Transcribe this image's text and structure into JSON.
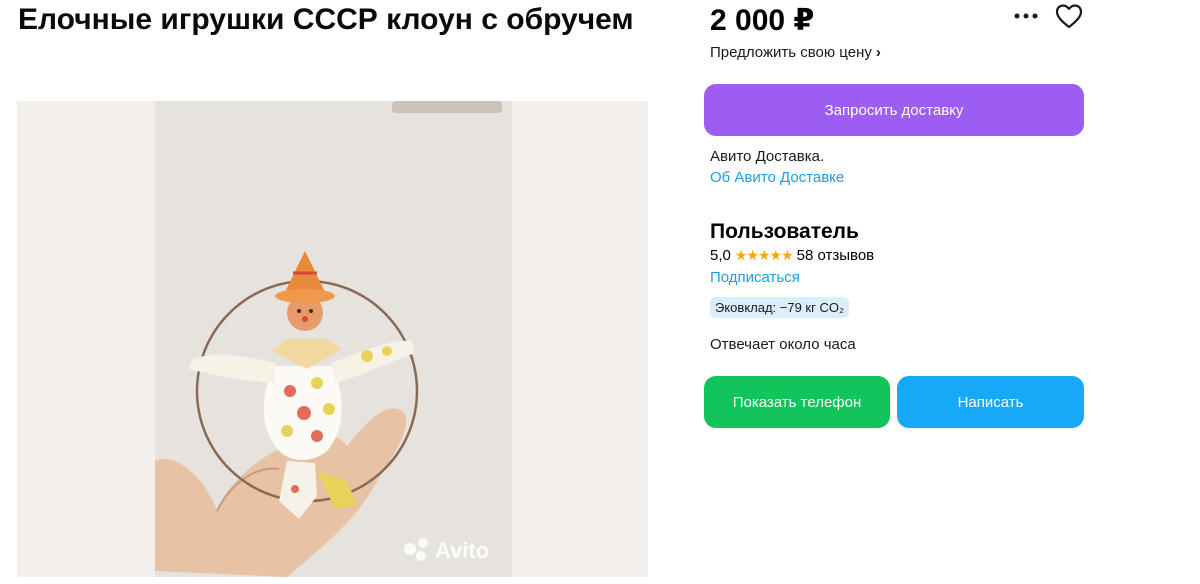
{
  "listing": {
    "title": "Елочные игрушки СССР клоун с обручем",
    "price": "2 000 ₽",
    "offer_link": "Предложить свою цену",
    "offer_chevron": "›",
    "photo": {
      "watermark": "Avito",
      "description_icon": "clown-ornament-photo"
    }
  },
  "actions": {
    "delivery_button": "Запросить доставку",
    "delivery_note": "Авито Доставка.",
    "delivery_info_link": "Об Авито Доставке",
    "show_phone_button": "Показать телефон",
    "write_button": "Написать"
  },
  "seller": {
    "name": "Пользователь",
    "rating": "5,0",
    "stars": "★★★★★",
    "reviews": "58 отзывов",
    "subscribe_link": "Подписаться",
    "eco_badge": "Эковклад: −79 кг CO₂",
    "response_time": "Отвечает около часа"
  },
  "icons": {
    "more": "more-dots-icon",
    "favorite": "heart-icon"
  },
  "colors": {
    "delivery_button": "#9d5cf2",
    "phone_button": "#12c55a",
    "write_button": "#17a8f7",
    "link": "#1d9de8",
    "stars": "#ffa500",
    "eco_badge_bg": "#dbeefb"
  }
}
